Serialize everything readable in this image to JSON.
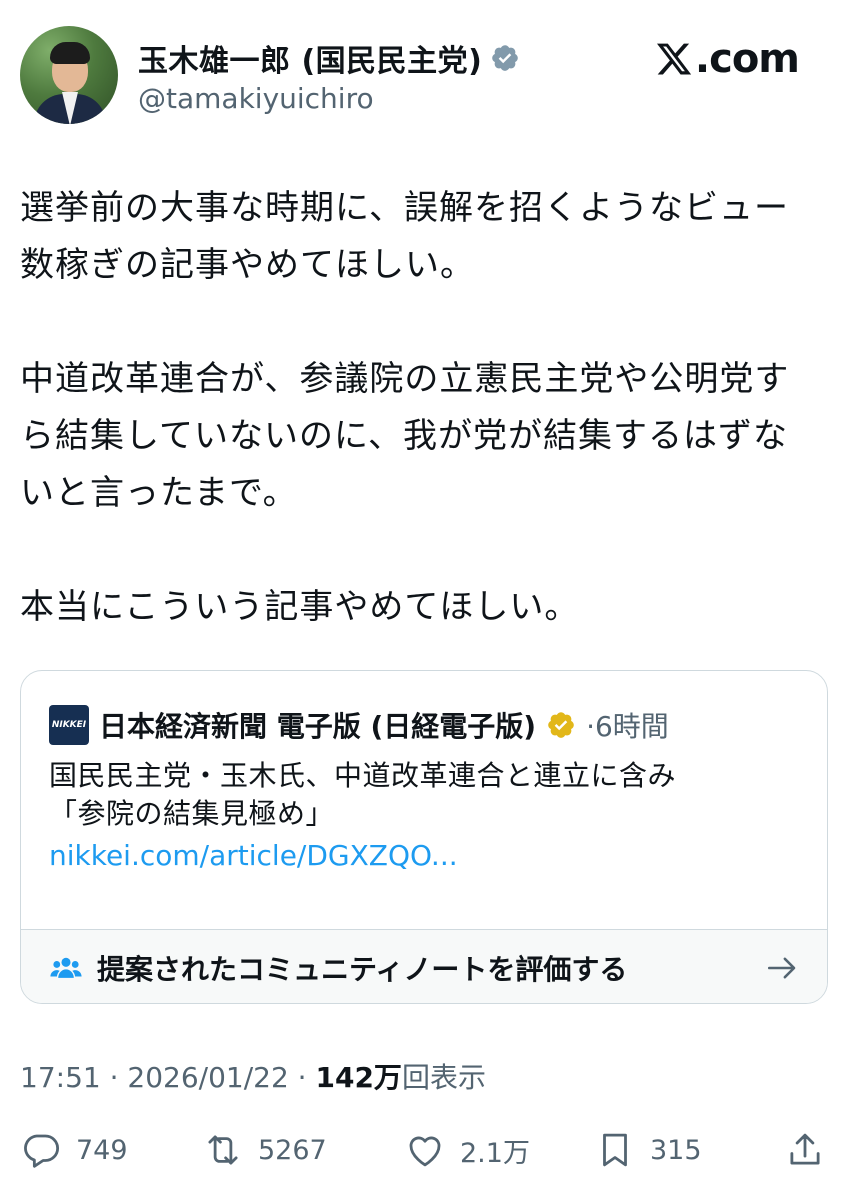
{
  "author": {
    "name": "玉木雄一郎 (国民民主党)",
    "handle": "@tamakiyuichiro"
  },
  "brand": {
    "logo_text": ".com"
  },
  "tweet": {
    "text": "選挙前の大事な時期に、誤解を招くようなビュー\n数稼ぎの記事やめてほしい。\n\n中道改革連合が、参議院の立憲民主党や公明党す\nら結集していないのに、我が党が結集するはずな\nいと言ったまで。\n\n本当にこういう記事やめてほしい。"
  },
  "quote": {
    "logo_text": "NIKKEI",
    "name": "日本経済新聞 電子版 (日経電子版)",
    "time": "·6時間",
    "body_line1": "国民民主党・玉木氏、中道改革連合と連立に含み",
    "body_line2": "「参院の結集見極め」",
    "link": "nikkei.com/article/DGXZQO..."
  },
  "community_note": {
    "label": "提案されたコミュニティノートを評価する"
  },
  "meta": {
    "timestamp": "17:51 · 2026/01/22 · ",
    "views_count": "142万",
    "views_label": "回表示"
  },
  "actions": {
    "replies": "749",
    "reposts": "5267",
    "likes": "2.1万",
    "bookmarks": "315"
  },
  "colors": {
    "link": "#1d9bf0",
    "secondary_text": "#536471",
    "verified_badge": "#829aab",
    "gold_badge": "#e2b719",
    "nikkei_logo": "#162f52"
  }
}
